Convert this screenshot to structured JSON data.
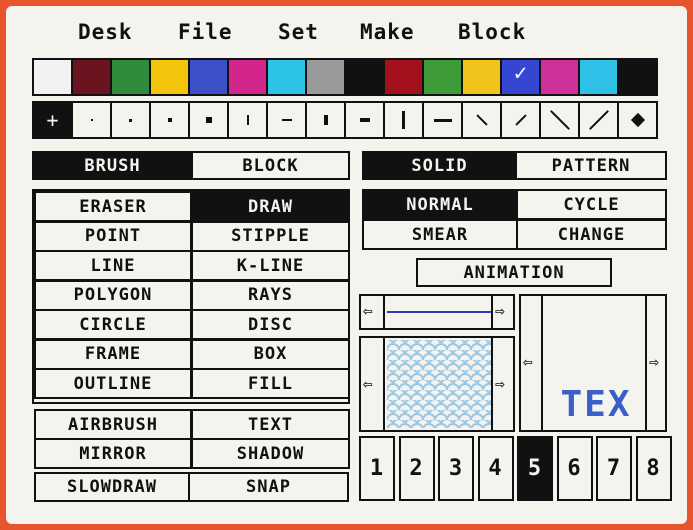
{
  "menu": [
    "Desk",
    "File",
    "Set",
    "Make",
    "Block"
  ],
  "palette": {
    "colors": [
      "#f2f2f2",
      "#6b1420",
      "#2f8c3a",
      "#f2c40c",
      "#3c50c8",
      "#d3268c",
      "#2cc3e6",
      "#9a9a9a",
      "#111111",
      "#a3121c",
      "#3f9a3a",
      "#f0c41a",
      "#3446d2",
      "#d0309a",
      "#2fc0e8",
      "#111111"
    ],
    "selected_index": 12,
    "selected_mark": "✓"
  },
  "brush_sizes": [
    {
      "icon": "crosshair-icon",
      "glyph": "+"
    },
    {
      "icon": "dot-1-icon"
    },
    {
      "icon": "dot-2-icon"
    },
    {
      "icon": "dot-3-icon"
    },
    {
      "icon": "dot-4-icon"
    },
    {
      "icon": "vbar-small-icon"
    },
    {
      "icon": "hbar-small-icon"
    },
    {
      "icon": "vbar-medium-icon"
    },
    {
      "icon": "hbar-medium-icon"
    },
    {
      "icon": "vbar-large-icon"
    },
    {
      "icon": "hbar-large-icon"
    },
    {
      "icon": "diag-back-small-icon"
    },
    {
      "icon": "diag-fwd-small-icon"
    },
    {
      "icon": "diag-back-large-icon"
    },
    {
      "icon": "diag-fwd-large-icon"
    },
    {
      "icon": "diamond-icon"
    }
  ],
  "mode": {
    "brush": "BRUSH",
    "block": "BLOCK",
    "selected": "brush"
  },
  "fill": {
    "solid": "SOLID",
    "pattern": "PATTERN",
    "selected": "solid"
  },
  "tools": [
    [
      "ERASER",
      "DRAW"
    ],
    [
      "POINT",
      "STIPPLE"
    ],
    [
      "LINE",
      "K-LINE"
    ],
    [
      "POLYGON",
      "RAYS"
    ],
    [
      "CIRCLE",
      "DISC"
    ],
    [
      "FRAME",
      "BOX"
    ],
    [
      "OUTLINE",
      "FILL"
    ]
  ],
  "tools_selected": "DRAW",
  "extras": [
    [
      "AIRBRUSH",
      "TEXT"
    ],
    [
      "MIRROR",
      "SHADOW"
    ]
  ],
  "bottom": [
    "SLOWDRAW",
    "SNAP"
  ],
  "draw_modes": [
    [
      "NORMAL",
      "CYCLE"
    ],
    [
      "SMEAR",
      "CHANGE"
    ]
  ],
  "draw_mode_selected": "NORMAL",
  "animation": "ANIMATION",
  "text_preview": "TEX",
  "slots": [
    "1",
    "2",
    "3",
    "4",
    "5",
    "6",
    "7",
    "8"
  ],
  "slot_selected": "5",
  "colors": {
    "text_preview": "#3a5fc8",
    "pattern": "#9cc8e4",
    "line": "#2a3cb4"
  }
}
